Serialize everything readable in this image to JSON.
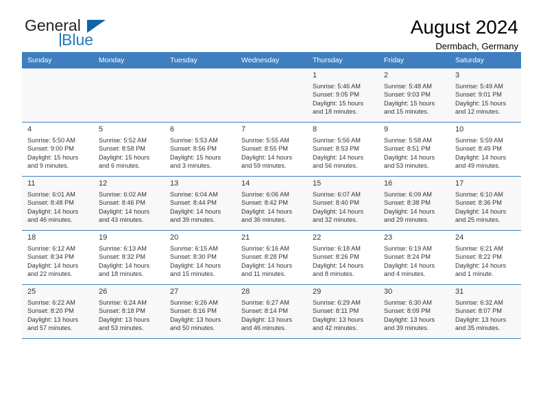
{
  "brand": {
    "name_part1": "General",
    "name_part2": "Blue",
    "accent_color": "#1064a8"
  },
  "header": {
    "title": "August 2024",
    "subtitle": "Dermbach, Germany"
  },
  "theme": {
    "header_row_bg": "#3f7fbf",
    "header_row_text": "#ffffff",
    "alt_row_bg": "#f8f8f8",
    "cell_text": "#333333"
  },
  "weekday_headers": [
    "Sunday",
    "Monday",
    "Tuesday",
    "Wednesday",
    "Thursday",
    "Friday",
    "Saturday"
  ],
  "weeks": [
    [
      {
        "day": "",
        "sunrise": "",
        "sunset": "",
        "daylight_line1": "",
        "daylight_line2": ""
      },
      {
        "day": "",
        "sunrise": "",
        "sunset": "",
        "daylight_line1": "",
        "daylight_line2": ""
      },
      {
        "day": "",
        "sunrise": "",
        "sunset": "",
        "daylight_line1": "",
        "daylight_line2": ""
      },
      {
        "day": "",
        "sunrise": "",
        "sunset": "",
        "daylight_line1": "",
        "daylight_line2": ""
      },
      {
        "day": "1",
        "sunrise": "Sunrise: 5:46 AM",
        "sunset": "Sunset: 9:05 PM",
        "daylight_line1": "Daylight: 15 hours",
        "daylight_line2": "and 18 minutes."
      },
      {
        "day": "2",
        "sunrise": "Sunrise: 5:48 AM",
        "sunset": "Sunset: 9:03 PM",
        "daylight_line1": "Daylight: 15 hours",
        "daylight_line2": "and 15 minutes."
      },
      {
        "day": "3",
        "sunrise": "Sunrise: 5:49 AM",
        "sunset": "Sunset: 9:01 PM",
        "daylight_line1": "Daylight: 15 hours",
        "daylight_line2": "and 12 minutes."
      }
    ],
    [
      {
        "day": "4",
        "sunrise": "Sunrise: 5:50 AM",
        "sunset": "Sunset: 9:00 PM",
        "daylight_line1": "Daylight: 15 hours",
        "daylight_line2": "and 9 minutes."
      },
      {
        "day": "5",
        "sunrise": "Sunrise: 5:52 AM",
        "sunset": "Sunset: 8:58 PM",
        "daylight_line1": "Daylight: 15 hours",
        "daylight_line2": "and 6 minutes."
      },
      {
        "day": "6",
        "sunrise": "Sunrise: 5:53 AM",
        "sunset": "Sunset: 8:56 PM",
        "daylight_line1": "Daylight: 15 hours",
        "daylight_line2": "and 3 minutes."
      },
      {
        "day": "7",
        "sunrise": "Sunrise: 5:55 AM",
        "sunset": "Sunset: 8:55 PM",
        "daylight_line1": "Daylight: 14 hours",
        "daylight_line2": "and 59 minutes."
      },
      {
        "day": "8",
        "sunrise": "Sunrise: 5:56 AM",
        "sunset": "Sunset: 8:53 PM",
        "daylight_line1": "Daylight: 14 hours",
        "daylight_line2": "and 56 minutes."
      },
      {
        "day": "9",
        "sunrise": "Sunrise: 5:58 AM",
        "sunset": "Sunset: 8:51 PM",
        "daylight_line1": "Daylight: 14 hours",
        "daylight_line2": "and 53 minutes."
      },
      {
        "day": "10",
        "sunrise": "Sunrise: 5:59 AM",
        "sunset": "Sunset: 8:49 PM",
        "daylight_line1": "Daylight: 14 hours",
        "daylight_line2": "and 49 minutes."
      }
    ],
    [
      {
        "day": "11",
        "sunrise": "Sunrise: 6:01 AM",
        "sunset": "Sunset: 8:48 PM",
        "daylight_line1": "Daylight: 14 hours",
        "daylight_line2": "and 46 minutes."
      },
      {
        "day": "12",
        "sunrise": "Sunrise: 6:02 AM",
        "sunset": "Sunset: 8:46 PM",
        "daylight_line1": "Daylight: 14 hours",
        "daylight_line2": "and 43 minutes."
      },
      {
        "day": "13",
        "sunrise": "Sunrise: 6:04 AM",
        "sunset": "Sunset: 8:44 PM",
        "daylight_line1": "Daylight: 14 hours",
        "daylight_line2": "and 39 minutes."
      },
      {
        "day": "14",
        "sunrise": "Sunrise: 6:06 AM",
        "sunset": "Sunset: 8:42 PM",
        "daylight_line1": "Daylight: 14 hours",
        "daylight_line2": "and 36 minutes."
      },
      {
        "day": "15",
        "sunrise": "Sunrise: 6:07 AM",
        "sunset": "Sunset: 8:40 PM",
        "daylight_line1": "Daylight: 14 hours",
        "daylight_line2": "and 32 minutes."
      },
      {
        "day": "16",
        "sunrise": "Sunrise: 6:09 AM",
        "sunset": "Sunset: 8:38 PM",
        "daylight_line1": "Daylight: 14 hours",
        "daylight_line2": "and 29 minutes."
      },
      {
        "day": "17",
        "sunrise": "Sunrise: 6:10 AM",
        "sunset": "Sunset: 8:36 PM",
        "daylight_line1": "Daylight: 14 hours",
        "daylight_line2": "and 25 minutes."
      }
    ],
    [
      {
        "day": "18",
        "sunrise": "Sunrise: 6:12 AM",
        "sunset": "Sunset: 8:34 PM",
        "daylight_line1": "Daylight: 14 hours",
        "daylight_line2": "and 22 minutes."
      },
      {
        "day": "19",
        "sunrise": "Sunrise: 6:13 AM",
        "sunset": "Sunset: 8:32 PM",
        "daylight_line1": "Daylight: 14 hours",
        "daylight_line2": "and 18 minutes."
      },
      {
        "day": "20",
        "sunrise": "Sunrise: 6:15 AM",
        "sunset": "Sunset: 8:30 PM",
        "daylight_line1": "Daylight: 14 hours",
        "daylight_line2": "and 15 minutes."
      },
      {
        "day": "21",
        "sunrise": "Sunrise: 6:16 AM",
        "sunset": "Sunset: 8:28 PM",
        "daylight_line1": "Daylight: 14 hours",
        "daylight_line2": "and 11 minutes."
      },
      {
        "day": "22",
        "sunrise": "Sunrise: 6:18 AM",
        "sunset": "Sunset: 8:26 PM",
        "daylight_line1": "Daylight: 14 hours",
        "daylight_line2": "and 8 minutes."
      },
      {
        "day": "23",
        "sunrise": "Sunrise: 6:19 AM",
        "sunset": "Sunset: 8:24 PM",
        "daylight_line1": "Daylight: 14 hours",
        "daylight_line2": "and 4 minutes."
      },
      {
        "day": "24",
        "sunrise": "Sunrise: 6:21 AM",
        "sunset": "Sunset: 8:22 PM",
        "daylight_line1": "Daylight: 14 hours",
        "daylight_line2": "and 1 minute."
      }
    ],
    [
      {
        "day": "25",
        "sunrise": "Sunrise: 6:22 AM",
        "sunset": "Sunset: 8:20 PM",
        "daylight_line1": "Daylight: 13 hours",
        "daylight_line2": "and 57 minutes."
      },
      {
        "day": "26",
        "sunrise": "Sunrise: 6:24 AM",
        "sunset": "Sunset: 8:18 PM",
        "daylight_line1": "Daylight: 13 hours",
        "daylight_line2": "and 53 minutes."
      },
      {
        "day": "27",
        "sunrise": "Sunrise: 6:26 AM",
        "sunset": "Sunset: 8:16 PM",
        "daylight_line1": "Daylight: 13 hours",
        "daylight_line2": "and 50 minutes."
      },
      {
        "day": "28",
        "sunrise": "Sunrise: 6:27 AM",
        "sunset": "Sunset: 8:14 PM",
        "daylight_line1": "Daylight: 13 hours",
        "daylight_line2": "and 46 minutes."
      },
      {
        "day": "29",
        "sunrise": "Sunrise: 6:29 AM",
        "sunset": "Sunset: 8:11 PM",
        "daylight_line1": "Daylight: 13 hours",
        "daylight_line2": "and 42 minutes."
      },
      {
        "day": "30",
        "sunrise": "Sunrise: 6:30 AM",
        "sunset": "Sunset: 8:09 PM",
        "daylight_line1": "Daylight: 13 hours",
        "daylight_line2": "and 39 minutes."
      },
      {
        "day": "31",
        "sunrise": "Sunrise: 6:32 AM",
        "sunset": "Sunset: 8:07 PM",
        "daylight_line1": "Daylight: 13 hours",
        "daylight_line2": "and 35 minutes."
      }
    ]
  ]
}
